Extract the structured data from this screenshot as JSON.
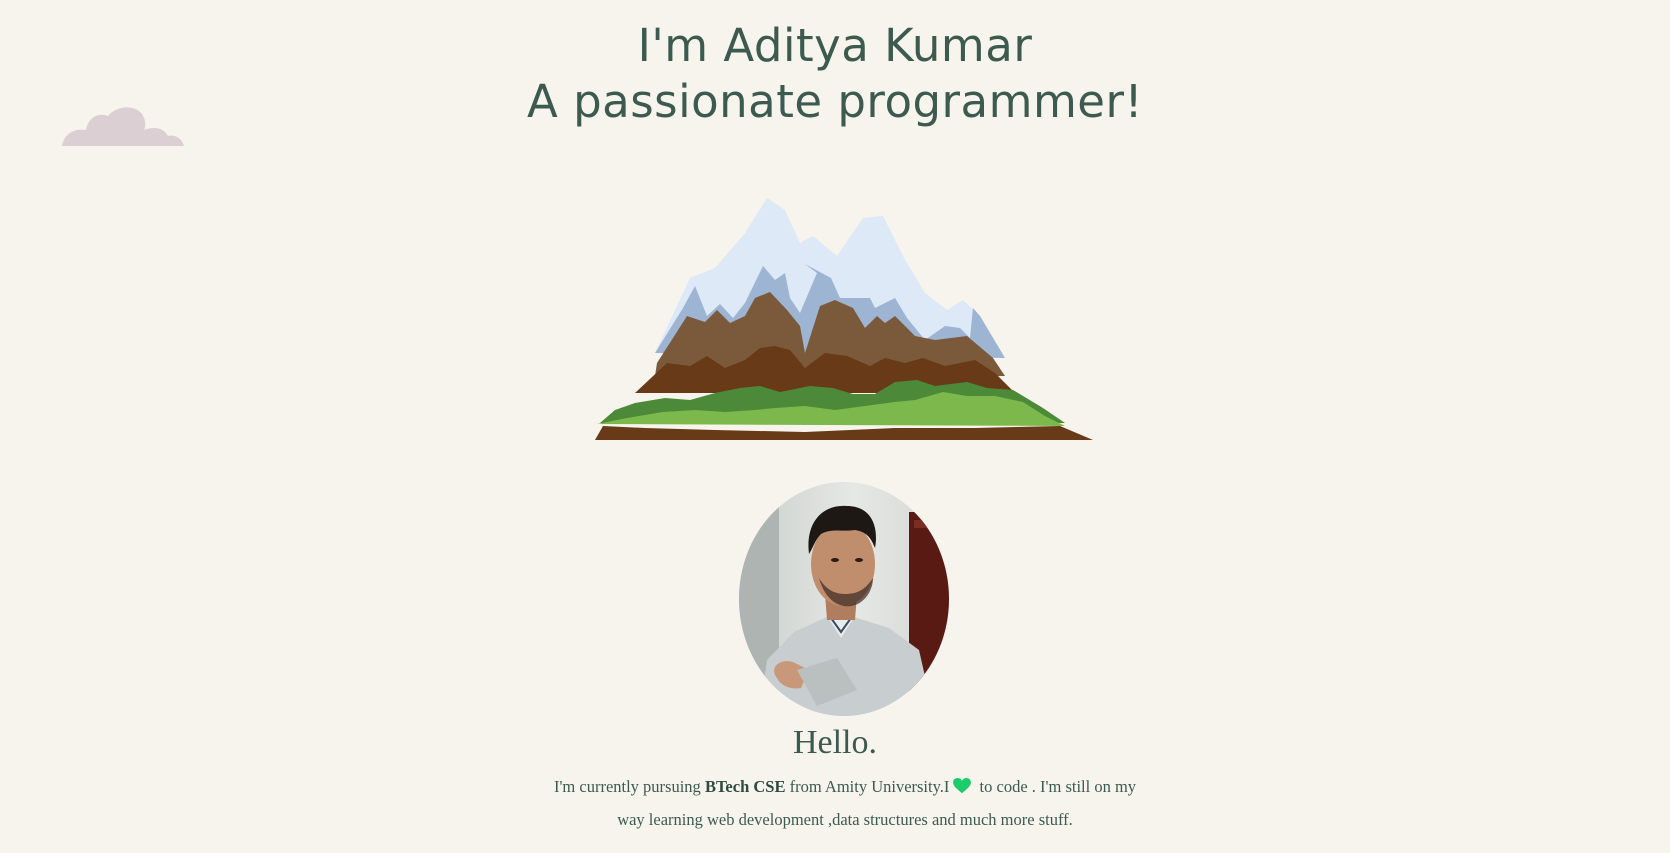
{
  "hero": {
    "line1": "I'm Aditya Kumar",
    "line2": "A passionate programmer!"
  },
  "about": {
    "heading": "Hello.",
    "text_before": "I'm currently pursuing ",
    "degree": "BTech CSE",
    "text_middle": " from Amity University.I",
    "heart_icon": "green-heart-icon",
    "text_after": " to code . I'm still on my way learning web development ,data structures and much more stuff."
  },
  "colors": {
    "background": "#f6f4ec",
    "heading_text": "#3d5a50",
    "cloud": "#dccfd3",
    "heart": "#1ccb6a"
  },
  "icons": {
    "cloud": "cloud-icon",
    "mountain": "mountain-illustration",
    "profile_photo": "profile-photo"
  }
}
